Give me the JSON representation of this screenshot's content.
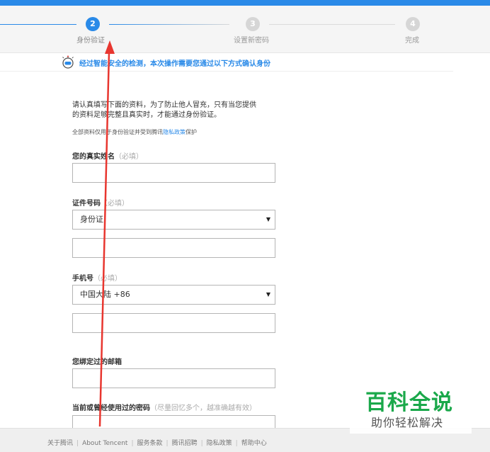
{
  "steps": [
    {
      "num": "2",
      "label": "身份验证"
    },
    {
      "num": "3",
      "label": "设置新密码"
    },
    {
      "num": "4",
      "label": "完成"
    }
  ],
  "notice": "经过智能安全的检测，本次操作需要您通过以下方式确认身份",
  "intro": {
    "line1": "请认真填写下面的资料，为了防止他人冒充，只有当您提供",
    "line2": "的资料足够完整且真实时，才能通过身份验证。",
    "privacy_prefix": "全部资料仅用于身份验证并受到腾讯",
    "privacy_link": "隐私政策",
    "privacy_suffix": "保护"
  },
  "form": {
    "name_label": "您的真实姓名",
    "name_hint": "（必填）",
    "name_value": "",
    "id_label": "证件号码",
    "id_hint": "（必填）",
    "id_type": "身份证",
    "id_value": "",
    "phone_label": "手机号",
    "phone_hint": "（必填）",
    "phone_region": "中国大陆 +86",
    "phone_value": "",
    "email_label": "您绑定过的邮箱",
    "email_value": "",
    "pwd_label": "当前或曾经使用过的密码",
    "pwd_hint": "（尽量回忆多个，越准确越有效）",
    "pwd_value": "",
    "caret": "▼"
  },
  "footer": {
    "links": [
      "关于腾讯",
      "About Tencent",
      "服务条款",
      "腾讯招聘",
      "隐私政策",
      "帮助中心"
    ],
    "separator": "|"
  },
  "watermark": {
    "title": "百科全说",
    "subtitle": "助你轻松解决"
  },
  "colors": {
    "accent": "#2a8ae8",
    "watermark": "#1aa84a",
    "arrow": "#e8362f"
  }
}
